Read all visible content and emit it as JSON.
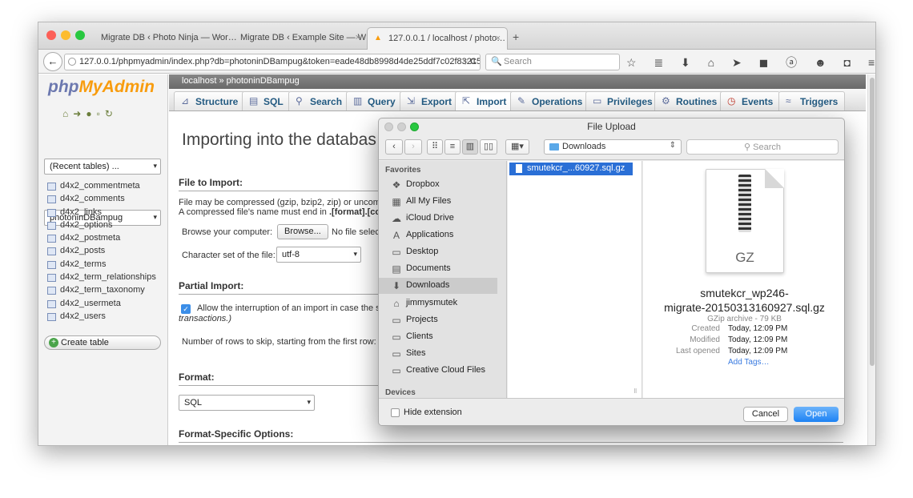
{
  "browser": {
    "tabs": [
      {
        "label": "Migrate DB ‹ Photo Ninja — Wor…",
        "close": "×"
      },
      {
        "label": "Migrate DB ‹ Example Site — W…",
        "close": "×"
      },
      {
        "label": "127.0.0.1 / localhost / photo…",
        "close": "×"
      }
    ],
    "new_tab": "+",
    "url": "127.0.0.1/phpmyadmin/index.php?db=photoninDBampug&token=eade48db8998d4de25ddf7c02f83215",
    "search_placeholder": "Search",
    "back": "←",
    "reload": "C",
    "toolbar_icons": "☆ ≣ ⬇ ⌂ ➤ ◼ ⓐ ☻ ◘ ≡ ⚙"
  },
  "sidebar": {
    "logo_php": "php",
    "logo_myadmin": "MyAdmin",
    "recent_tables": "(Recent tables) ...",
    "database": "photoninDBampug",
    "tables": [
      "d4x2_commentmeta",
      "d4x2_comments",
      "d4x2_links",
      "d4x2_options",
      "d4x2_postmeta",
      "d4x2_posts",
      "d4x2_terms",
      "d4x2_term_relationships",
      "d4x2_term_taxonomy",
      "d4x2_usermeta",
      "d4x2_users"
    ],
    "create_table": "Create table"
  },
  "main": {
    "breadcrumb": "localhost » photoninDBampug",
    "tabs": [
      "Structure",
      "SQL",
      "Search",
      "Query",
      "Export",
      "Import",
      "Operations",
      "Privileges",
      "Routines",
      "Events",
      "Triggers"
    ],
    "heading": "Importing into the databas",
    "file_to_import": "File to Import:",
    "compress_note_1": "File may be compressed (gzip, bzip2, zip) or uncomp",
    "compress_note_2_pre": "A compressed file's name must end in ",
    "compress_note_2_bold": ".[format].[co",
    "browse_label": "Browse your computer:",
    "browse_button": "Browse...",
    "no_file": "No file selec",
    "charset_label": "Character set of the file:",
    "charset_value": "utf-8",
    "partial_import": "Partial Import:",
    "allow_interrupt": "Allow the interruption of an import in case the sc",
    "transactions": "transactions.)",
    "rows_skip_label": "Number of rows to skip, starting from the first row:",
    "format": "Format:",
    "format_value": "SQL",
    "format_specific": "Format-Specific Options:"
  },
  "dialog": {
    "title": "File Upload",
    "location": "Downloads",
    "search_placeholder": "Search",
    "favorites_header": "Favorites",
    "devices_header": "Devices",
    "favorites": [
      "Dropbox",
      "All My Files",
      "iCloud Drive",
      "Applications",
      "Desktop",
      "Documents",
      "Downloads",
      "jimmysmutek",
      "Projects",
      "Clients",
      "Sites",
      "Creative Cloud Files"
    ],
    "selected_file": "smutekcr_...60927.sql.gz",
    "preview_icon_label": "GZ",
    "preview_name_1": "smutekcr_wp246-",
    "preview_name_2": "migrate-20150313160927.sql.gz",
    "preview_kind": "GZip archive - 79 KB",
    "meta": [
      {
        "key": "Created",
        "value": "Today, 12:09 PM"
      },
      {
        "key": "Modified",
        "value": "Today, 12:09 PM"
      },
      {
        "key": "Last opened",
        "value": "Today, 12:09 PM"
      }
    ],
    "add_tags": "Add Tags…",
    "hide_extension": "Hide extension",
    "cancel": "Cancel",
    "open": "Open"
  },
  "colors": {
    "accent_blue": "#2a6fd6",
    "open_button": "#1d82f4",
    "pma_link": "#235a81",
    "link_blue": "#3a7be0"
  }
}
